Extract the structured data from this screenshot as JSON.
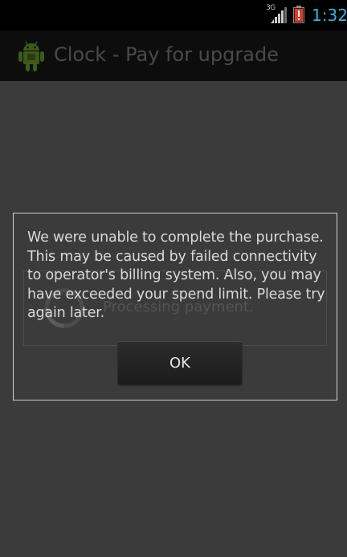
{
  "status_bar": {
    "network_type": "3G",
    "time": "1:32",
    "icons": [
      "signal-icon",
      "battery-alert-icon"
    ]
  },
  "action_bar": {
    "title": "Clock - Pay for upgrade",
    "icon": "android-icon"
  },
  "progress": {
    "text": "Processing payment."
  },
  "dialog": {
    "message": "We were unable to complete the purchase. This may be caused by failed connectivity to operator's billing system. Also, you may have exceeded your spend limit. Please try again later.",
    "ok_label": "OK"
  },
  "colors": {
    "status_time": "#35b5e5",
    "battery_alert": "#e23b2a",
    "background": "#3a3b3a"
  }
}
